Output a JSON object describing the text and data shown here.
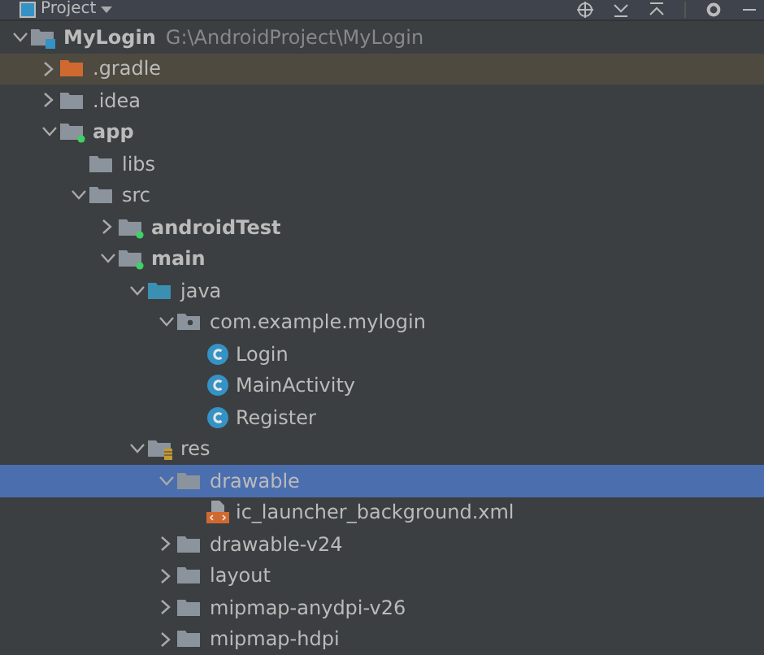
{
  "toolbar": {
    "title": "Project"
  },
  "tree": [
    {
      "label": "MyLogin",
      "path": "G:\\AndroidProject\\MyLogin",
      "kind": "project",
      "expanded": true,
      "selected": false,
      "children": [
        {
          "label": ".gradle",
          "kind": "excluded",
          "expanded": false,
          "selected": false
        },
        {
          "label": ".idea",
          "kind": "folder",
          "expanded": false,
          "selected": false
        },
        {
          "label": "app",
          "kind": "module",
          "expanded": true,
          "selected": false,
          "children": [
            {
              "label": "libs",
              "kind": "folder",
              "selected": false
            },
            {
              "label": "src",
              "kind": "folder",
              "expanded": true,
              "selected": false,
              "children": [
                {
                  "label": "androidTest",
                  "kind": "module",
                  "expanded": false,
                  "selected": false
                },
                {
                  "label": "main",
                  "kind": "module",
                  "expanded": true,
                  "selected": false,
                  "children": [
                    {
                      "label": "java",
                      "kind": "source",
                      "expanded": true,
                      "selected": false,
                      "children": [
                        {
                          "label": "com.example.mylogin",
                          "kind": "package",
                          "expanded": true,
                          "selected": false,
                          "children": [
                            {
                              "label": "Login",
                              "kind": "class",
                              "selected": false
                            },
                            {
                              "label": "MainActivity",
                              "kind": "class",
                              "selected": false
                            },
                            {
                              "label": "Register",
                              "kind": "class",
                              "selected": false
                            }
                          ]
                        }
                      ]
                    },
                    {
                      "label": "res",
                      "kind": "resources",
                      "expanded": true,
                      "selected": false,
                      "children": [
                        {
                          "label": "drawable",
                          "kind": "folder",
                          "expanded": true,
                          "selected": true,
                          "children": [
                            {
                              "label": "ic_launcher_background.xml",
                              "kind": "xml",
                              "selected": false
                            }
                          ]
                        },
                        {
                          "label": "drawable-v24",
                          "kind": "folder",
                          "expanded": false,
                          "selected": false
                        },
                        {
                          "label": "layout",
                          "kind": "folder",
                          "expanded": false,
                          "selected": false
                        },
                        {
                          "label": "mipmap-anydpi-v26",
                          "kind": "folder",
                          "expanded": false,
                          "selected": false
                        },
                        {
                          "label": "mipmap-hdpi",
                          "kind": "folder",
                          "expanded": false,
                          "selected": false
                        }
                      ]
                    }
                  ]
                }
              ]
            }
          ]
        }
      ]
    }
  ]
}
